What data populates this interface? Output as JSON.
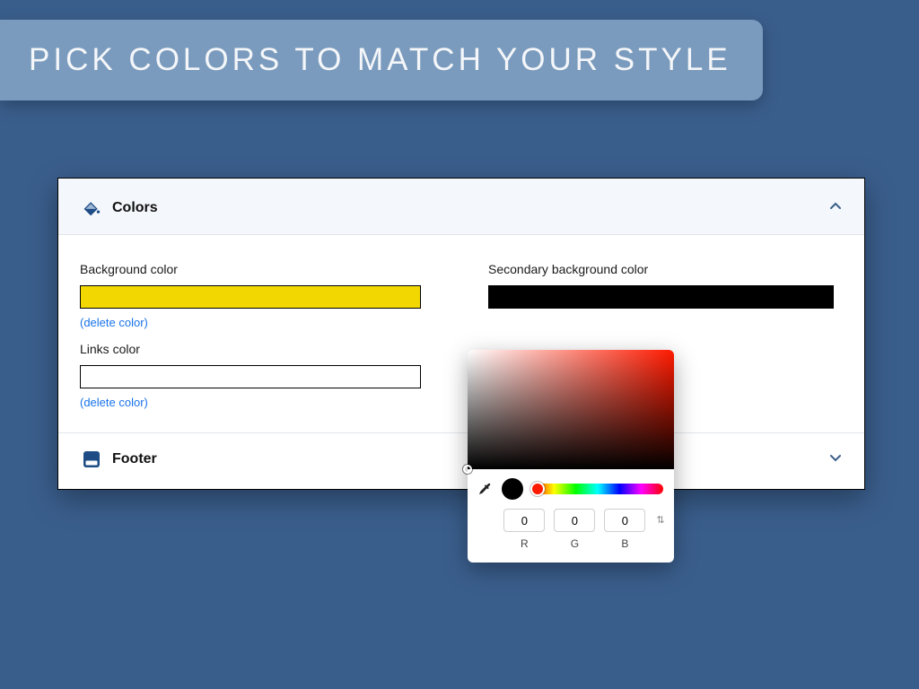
{
  "banner": {
    "text": "PICK COLORS TO MATCH YOUR STYLE"
  },
  "sections": {
    "colors": {
      "title": "Colors",
      "expanded": true,
      "fields": {
        "background": {
          "label": "Background color",
          "value": "#f2d700",
          "delete_label": "(delete color)"
        },
        "links": {
          "label": "Links color",
          "value": "#ffffff",
          "delete_label": "(delete color)"
        },
        "secondary_background": {
          "label": "Secondary background color",
          "value": "#000000"
        }
      }
    },
    "footer": {
      "title": "Footer",
      "expanded": false
    }
  },
  "picker": {
    "r": "0",
    "g": "0",
    "b": "0",
    "r_label": "R",
    "g_label": "G",
    "b_label": "B",
    "mode_toggle": "⇅",
    "current_color": "#000000",
    "hue_color": "#ff1a00"
  }
}
